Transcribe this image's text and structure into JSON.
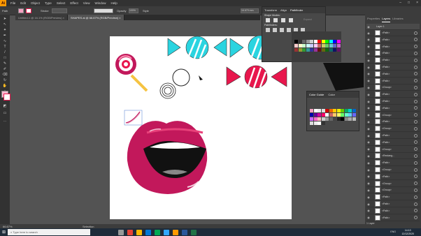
{
  "app": {
    "logo": "Ai"
  },
  "menubar": {
    "items": [
      "File",
      "Edit",
      "Object",
      "Type",
      "Select",
      "Effect",
      "View",
      "Window",
      "Help"
    ]
  },
  "controlbar": {
    "selection_label": "Path",
    "stroke_label": "Stroke",
    "opacity_label": "Opacity",
    "opacity_value": "100%",
    "style_label": "Style",
    "zoom_value": "16.679 mm"
  },
  "tabs": [
    {
      "label": "Untitled-1 @ 16.1% (RGB/Preview)",
      "active": false
    },
    {
      "label": "SHAPES.ai @ 66.67% (RGB/Preview)",
      "active": true
    }
  ],
  "pathfinder": {
    "tabs": [
      "Transform",
      "Align",
      "Pathfinder"
    ],
    "shape_modes_label": "Shape Modes:",
    "pathfinders_label": "Pathfinders:",
    "expand_label": "Expand"
  },
  "colorguide": {
    "tabs": [
      "Color Guide",
      "Color"
    ]
  },
  "layers": {
    "tabs": [
      "Properties",
      "Layers",
      "Libraries"
    ],
    "top_layer": "Layer 1",
    "rows": [
      "<Path>",
      "<Path>",
      "<Path>",
      "<Path>",
      "<Path>",
      "<Path>",
      "<Path>",
      "<Path>",
      "<Group>",
      "<Path>",
      "<Path>",
      "<Path>",
      "<Group>",
      "<Path>",
      "<Group>",
      "<Path>",
      "<Path>",
      "<Group>",
      "<Rectang...",
      "<Path>",
      "<Group>",
      "<Path>",
      "<Group>",
      "<Group>",
      "<Path>",
      "<Path>",
      "<Path>",
      "<Path>"
    ],
    "footer": "1 Layer"
  },
  "status": {
    "zoom": "66.67%",
    "tool": "Selection"
  },
  "taskbar": {
    "search_placeholder": "Type here to search",
    "time": "14:13",
    "date": "12/12/2020",
    "lang": "ENG"
  },
  "colors": {
    "cyan": "#2ad4e0",
    "red": "#e8174d",
    "magenta": "#c2185b",
    "gold": "#f5c342"
  }
}
